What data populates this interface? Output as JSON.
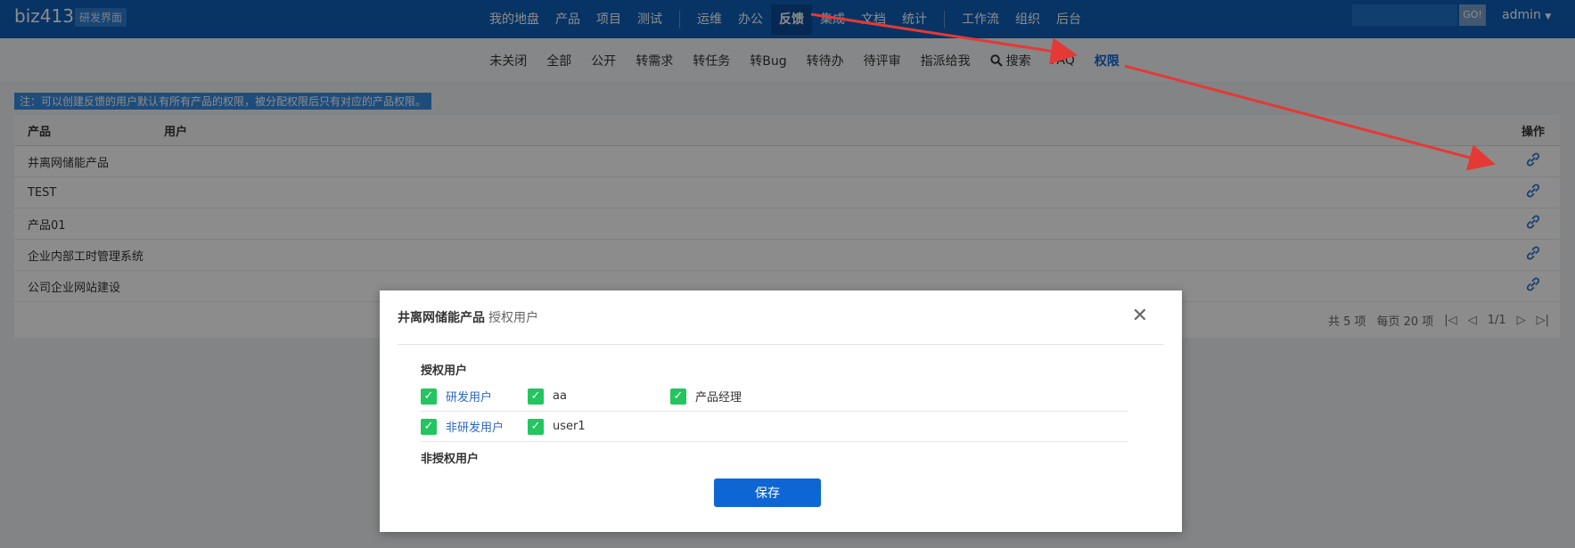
{
  "header": {
    "brand": "biz413",
    "brand_tag": "研发界面",
    "nav_left": [
      "我的地盘",
      "产品",
      "项目",
      "测试"
    ],
    "nav_mid": [
      "运维",
      "办公",
      "反馈",
      "集成",
      "文档",
      "统计"
    ],
    "nav_right": [
      "工作流",
      "组织",
      "后台"
    ],
    "active_nav": "反馈",
    "search_placeholder": "",
    "go_label": "GO!",
    "user": "admin"
  },
  "subnav": {
    "items": [
      "未关闭",
      "全部",
      "公开",
      "转需求",
      "转任务",
      "转Bug",
      "转待办",
      "待评审",
      "指派给我"
    ],
    "search_label": "搜索",
    "faq_label": "FAQ",
    "active_label": "权限"
  },
  "note": "注：可以创建反馈的用户默认有所有产品的权限，被分配权限后只有对应的产品权限。",
  "table": {
    "headers": {
      "product": "产品",
      "user": "用户",
      "op": "操作"
    },
    "rows": [
      {
        "product": "井离网储能产品",
        "user": ""
      },
      {
        "product": "TEST",
        "user": ""
      },
      {
        "product": "产品01",
        "user": ""
      },
      {
        "product": "企业内部工时管理系统",
        "user": ""
      },
      {
        "product": "公司企业网站建设",
        "user": ""
      }
    ],
    "pager": {
      "total": "共 5 项",
      "per_page": "每页 20 项",
      "page": "1/1"
    }
  },
  "modal": {
    "title": "井离网储能产品",
    "subtitle": "授权用户",
    "authorized_title": "授权用户",
    "row1": {
      "group": "研发用户",
      "users": [
        "aa",
        "产品经理"
      ]
    },
    "row2": {
      "group": "非研发用户",
      "users": [
        "user1"
      ]
    },
    "unauthorized_title": "非授权用户",
    "save_label": "保存"
  }
}
